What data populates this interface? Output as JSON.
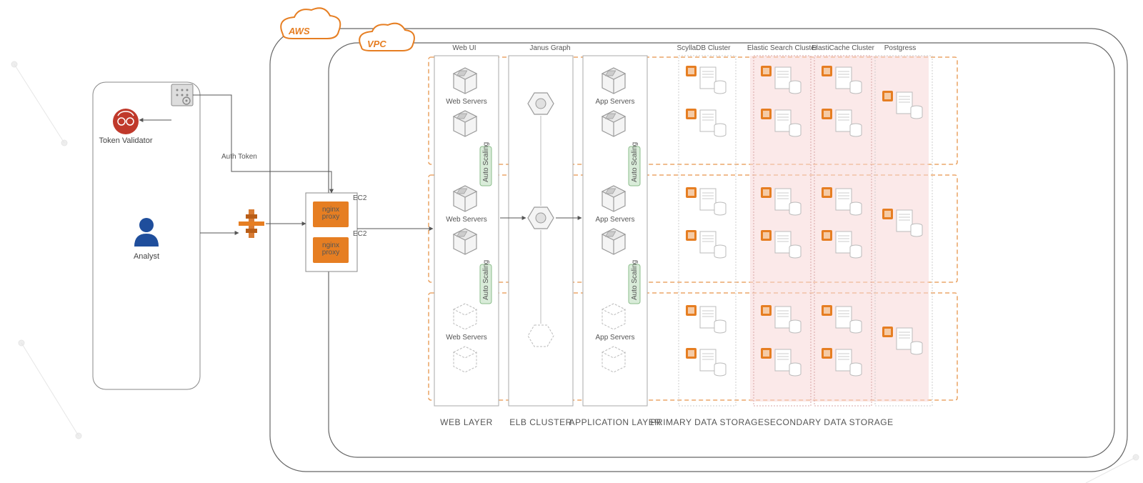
{
  "clouds": {
    "aws": "AWS",
    "vpc": "VPC"
  },
  "left": {
    "token_validator": "Token Validator",
    "analyst": "Analyst"
  },
  "auth": {
    "label": "Auth Token",
    "proxy": "nginx\nproxy",
    "ec2": "EC2"
  },
  "top": {
    "webui": "Web UI",
    "janus": "Janus Graph",
    "scylla": "ScyllaDB Cluster",
    "es": "Elastic Search Cluster",
    "ec": "ElastiCache Cluster",
    "pg": "Postgress"
  },
  "cols": {
    "web": "Web Servers",
    "app": "App Servers",
    "autoscale": "Auto Scaling"
  },
  "bottom": {
    "web": "WEB LAYER",
    "elb": "ELB CLUSTER",
    "app": "APPLICATION LAYER",
    "primary": "PRIMARY DATA STORAGE",
    "secondary": "SECONDARY DATA STORAGE"
  }
}
